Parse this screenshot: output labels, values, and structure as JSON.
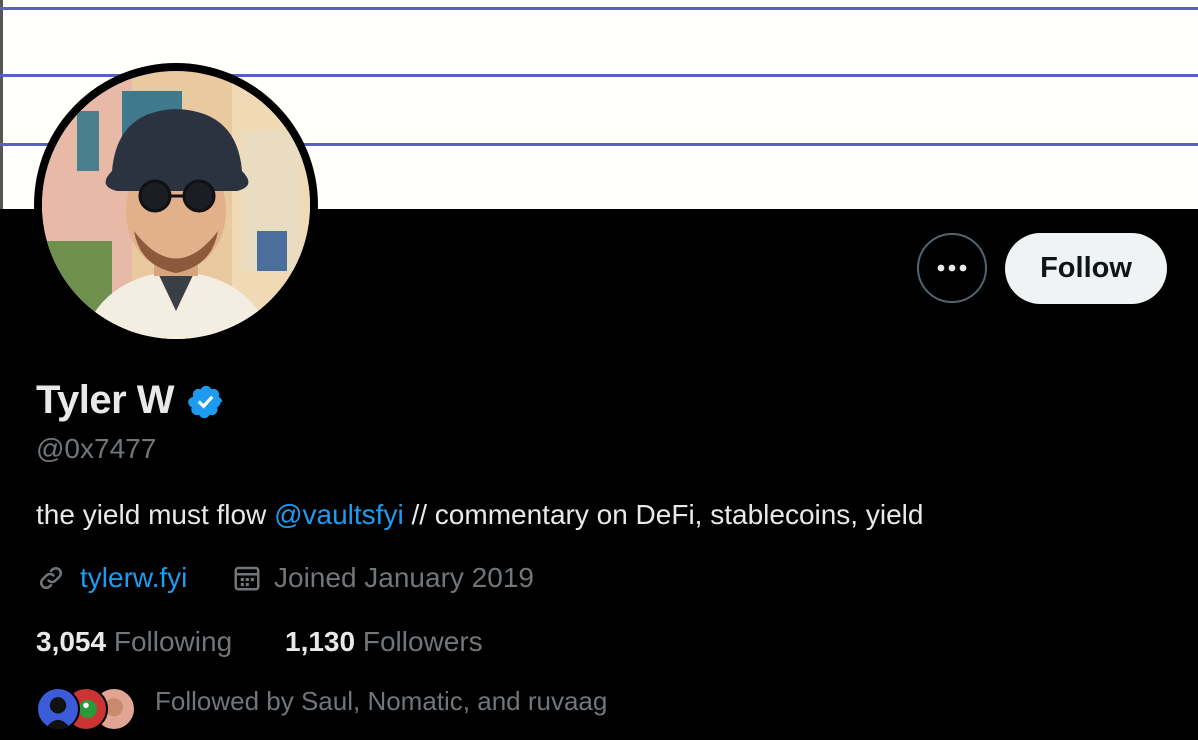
{
  "profile": {
    "name": "Tyler W",
    "handle": "@0x7477",
    "bio_prefix": "the yield must flow ",
    "bio_mention": "@vaultsfyi",
    "bio_suffix": " // commentary on DeFi, stablecoins, yield",
    "website": "tylerw.fyi",
    "joined": "Joined January 2019"
  },
  "stats": {
    "following_count": "3,054",
    "following_label": "Following",
    "followers_count": "1,130",
    "followers_label": "Followers"
  },
  "followed_by": "Followed by Saul, Nomatic, and ruvaag",
  "actions": {
    "follow_label": "Follow"
  },
  "icons": {
    "more": "more-horizontal-icon",
    "verified": "verified-badge-icon",
    "link": "link-icon",
    "calendar": "calendar-icon"
  },
  "colors": {
    "accent": "#1d9bf0",
    "background": "#000000",
    "text": "#e7e9ea",
    "muted": "#71767b",
    "banner": "#fffffb",
    "banner_lines": "#5a5fc8"
  }
}
